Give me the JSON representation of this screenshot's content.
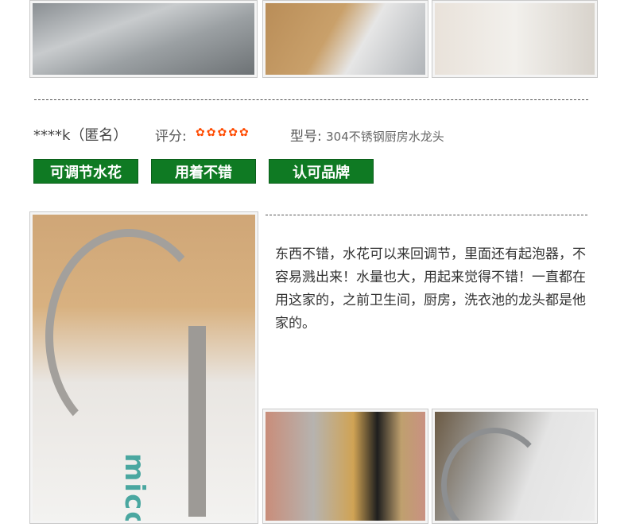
{
  "review": {
    "reviewer": "****k（匿名）",
    "rating_label": "评分:",
    "rating_stars": 5,
    "model_label": "型号:",
    "model_value": "304不锈钢厨房水龙头",
    "tags": [
      "可调节水花",
      "用着不错",
      "认可品牌"
    ],
    "text": "东西不错，水花可以来回调节，里面还有起泡器，不容易溅出来！水量也大，用起来觉得不错！一直都在用这家的，之前卫生间，厨房，洗衣池的龙头都是他家的。",
    "photo_brand_text": "micoe"
  },
  "colors": {
    "tag_bg": "#0f7a23",
    "star": "#ff4a00",
    "text": "#333333"
  }
}
